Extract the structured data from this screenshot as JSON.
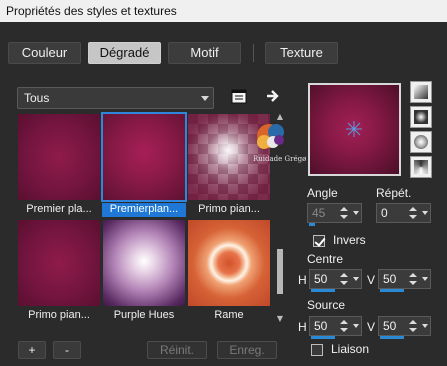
{
  "window": {
    "title": "Propriétés des styles et textures"
  },
  "tabs": [
    {
      "label": "Couleur",
      "active": false
    },
    {
      "label": "Dégradé",
      "active": true
    },
    {
      "label": "Motif",
      "active": false
    },
    {
      "label": "Texture",
      "active": false
    }
  ],
  "library": {
    "category": "Tous",
    "tiles": [
      {
        "label": "Premier pla...",
        "selected": false,
        "style": "burgundy-linear"
      },
      {
        "label": "Premierplan...",
        "selected": true,
        "style": "burgundy-radial"
      },
      {
        "label": "Primo pian...",
        "selected": false,
        "style": "checker-radial"
      },
      {
        "label": "Primo pian...",
        "selected": false,
        "style": "burgundy-linear"
      },
      {
        "label": "Purple Hues",
        "selected": false,
        "style": "purple-radial"
      },
      {
        "label": "Rame",
        "selected": false,
        "style": "copper-rings"
      }
    ],
    "scroll_fraction": 0.85
  },
  "toolbar": {
    "add_label": "+",
    "remove_label": "-",
    "reset_label": "Réinit.",
    "save_label": "Enreg."
  },
  "watermark": {
    "text": "Ruidade Grégø"
  },
  "gradient": {
    "angle_label": "Angle",
    "angle_value": "45",
    "repeat_label": "Répét.",
    "repeat_value": "0",
    "invert_label": "Invers",
    "invert_checked": true,
    "center_label": "Centre",
    "center_h_label": "H",
    "center_h_value": "50",
    "center_v_label": "V",
    "center_v_value": "50",
    "source_label": "Source",
    "source_h_label": "H",
    "source_h_value": "50",
    "source_v_label": "V",
    "source_v_value": "50",
    "link_label": "Liaison",
    "link_checked": false
  },
  "colors": {
    "accent": "#1f78d6",
    "burgundy": "#8a1a47",
    "background": "#2b2b2b"
  }
}
